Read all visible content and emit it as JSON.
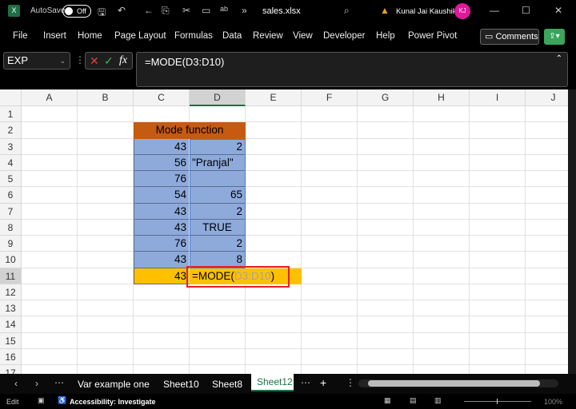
{
  "titlebar": {
    "autosave_label": "AutoSave",
    "autosave_state": "Off",
    "filename": "sales.xlsx",
    "user_name": "Kunal Jai Kaushik",
    "user_initials": "KJ",
    "app_icon": "excel-icon"
  },
  "ribbon": {
    "tabs": [
      "File",
      "Insert",
      "Home",
      "Page Layout",
      "Formulas",
      "Data",
      "Review",
      "View",
      "Developer",
      "Help",
      "Power Pivot"
    ],
    "comments_label": "Comments"
  },
  "formula_bar": {
    "name_box": "EXP",
    "formula": "=MODE(D3:D10)"
  },
  "columns": [
    "A",
    "B",
    "C",
    "D",
    "E",
    "F",
    "G",
    "H",
    "I",
    "J"
  ],
  "rows": [
    "1",
    "2",
    "3",
    "4",
    "5",
    "6",
    "7",
    "8",
    "9",
    "10",
    "11",
    "12",
    "13",
    "14",
    "15",
    "16",
    "17"
  ],
  "table": {
    "header": "Mode function",
    "col_c": [
      "43",
      "56",
      "76",
      "54",
      "43",
      "43",
      "76",
      "43"
    ],
    "col_d": [
      "2",
      "\"Pranjal\"",
      "",
      "65",
      "2",
      "TRUE",
      "2",
      "8"
    ],
    "result_c": "43",
    "formula_prefix": "=MODE(",
    "formula_range": "D3:D10",
    "formula_suffix": ")",
    "colors": {
      "header": "#c55a11",
      "data": "#8eaadb",
      "result": "#ffc000",
      "range_text": "#a5a5a5",
      "highlight_box": "#e0202a"
    }
  },
  "sheet_tabs": {
    "tabs": [
      "Var example one",
      "Sheet10",
      "Sheet8",
      "Sheet12"
    ],
    "active": "Sheet12"
  },
  "status": {
    "mode": "Edit",
    "accessibility": "Accessibility: Investigate",
    "zoom": "100%"
  }
}
